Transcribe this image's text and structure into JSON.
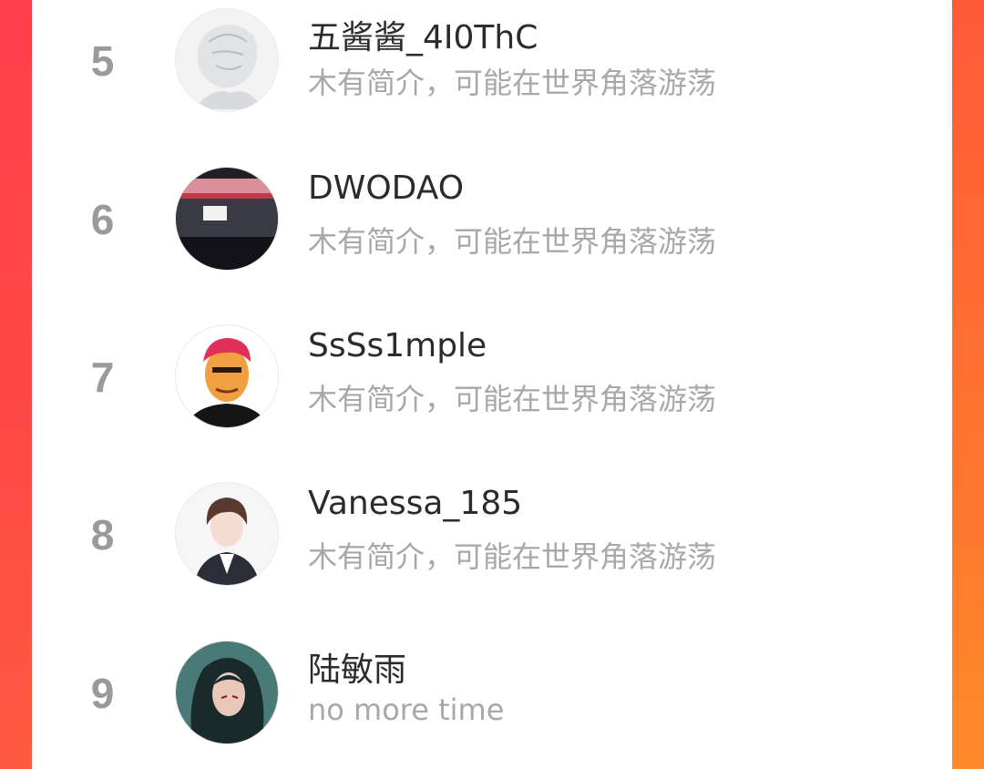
{
  "colors": {
    "accent_left": "#ff4a45",
    "accent_right": "#ff7a2e",
    "rank_text": "#9a9a9a",
    "name_text": "#2b2b2b",
    "bio_text": "#a8a8a8"
  },
  "users": [
    {
      "rank": "5",
      "name": "五酱酱_4I0ThC",
      "bio": "木有简介，可能在世界角落游荡",
      "avatar": "anime-sketch-avatar"
    },
    {
      "rank": "6",
      "name": "DWODAO",
      "bio": "木有简介，可能在世界角落游荡",
      "avatar": "bus-photo-avatar"
    },
    {
      "rank": "7",
      "name": "SsSs1mple",
      "bio": "木有简介，可能在世界角落游荡",
      "avatar": "red-hair-man-avatar"
    },
    {
      "rank": "8",
      "name": "Vanessa_185",
      "bio": "木有简介，可能在世界角落游荡",
      "avatar": "anime-boy-suit-avatar"
    },
    {
      "rank": "9",
      "name": "陆敏雨",
      "bio": "no more time",
      "avatar": "anime-long-hair-avatar"
    }
  ]
}
